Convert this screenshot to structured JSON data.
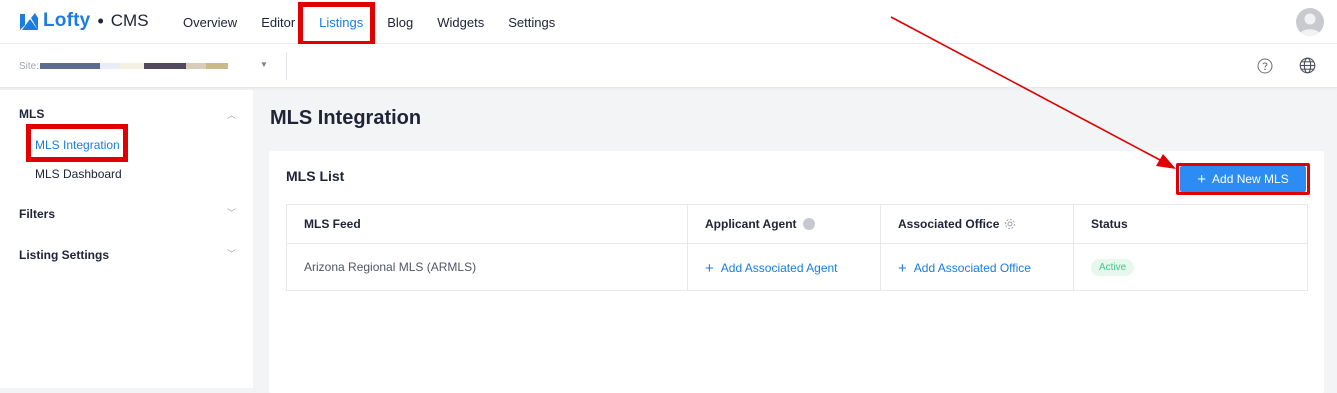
{
  "brand": {
    "name": "Lofty",
    "separator": "•",
    "product": "CMS"
  },
  "nav": {
    "items": [
      "Overview",
      "Editor",
      "Listings",
      "Blog",
      "Widgets",
      "Settings"
    ],
    "active": "Listings"
  },
  "site": {
    "label": "Site:"
  },
  "sidebar": {
    "groups": [
      {
        "label": "MLS",
        "expanded": true,
        "items": [
          "MLS Integration",
          "MLS Dashboard"
        ]
      },
      {
        "label": "Filters",
        "expanded": false
      },
      {
        "label": "Listing Settings",
        "expanded": false
      }
    ],
    "active_item": "MLS Integration"
  },
  "page": {
    "title": "MLS Integration"
  },
  "card": {
    "title": "MLS List",
    "add_button": "Add New MLS"
  },
  "table": {
    "headers": [
      "MLS Feed",
      "Applicant Agent",
      "Associated Office",
      "Status"
    ],
    "rows": [
      {
        "feed": "Arizona Regional MLS (ARMLS)",
        "agent_action": "Add Associated Agent",
        "office_action": "Add Associated Office",
        "status": "Active"
      }
    ]
  },
  "colors": {
    "accent": "#1c7ce0",
    "button": "#2c8cf4",
    "highlight": "#e00000",
    "status_active": "#3ec88a"
  },
  "icons": [
    "lofty-logo-icon",
    "avatar-icon",
    "chevron-down-icon",
    "help-icon",
    "globe-icon",
    "chevron-up-icon",
    "info-icon",
    "gear-icon",
    "plus-icon"
  ]
}
